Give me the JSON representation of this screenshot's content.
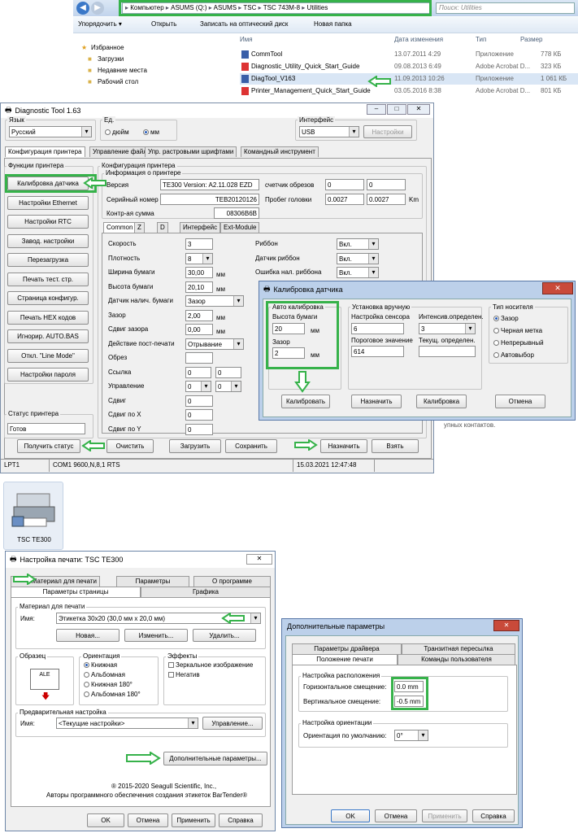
{
  "explorer": {
    "path": [
      "Компьютер",
      "ASUMS (Q:)",
      "ASUMS",
      "TSC",
      "TSC 743M-8",
      "Utilities"
    ],
    "search": "Поиск: Utilities",
    "toolbar": [
      "Упорядочить ▾",
      "Открыть",
      "Записать на оптический диск",
      "Новая папка"
    ],
    "cols": [
      "Имя",
      "Дата изменения",
      "Тип",
      "Размер"
    ],
    "nav": [
      "Избранное",
      "Загрузки",
      "Недавние места",
      "Рабочий стол"
    ],
    "files": [
      {
        "name": "CommTool",
        "date": "13.07.2011 4:29",
        "type": "Приложение",
        "size": "778 КБ"
      },
      {
        "name": "Diagnostic_Utility_Quick_Start_Guide",
        "date": "09.08.2013 6:49",
        "type": "Adobe Acrobat D...",
        "size": "323 КБ"
      },
      {
        "name": "DiagTool_V163",
        "date": "11.09.2013 10:26",
        "type": "Приложение",
        "size": "1 061 КБ"
      },
      {
        "name": "Printer_Management_Quick_Start_Guide",
        "date": "03.05.2016 8:38",
        "type": "Adobe Acrobat D...",
        "size": "801 КБ"
      }
    ]
  },
  "diag": {
    "title": "Diagnostic Tool 1.63",
    "lang_label": "Язык",
    "lang": "Русский",
    "unit_label": "Ед.",
    "units": [
      "дюйм",
      "мм"
    ],
    "iface_label": "Интерфейс",
    "iface": "USB",
    "settings_btn": "Настройки",
    "tabs": [
      "Конфигурация принтера",
      "Управление файлом",
      "Упр. растровыми шрифтами",
      "Командный инструмент"
    ],
    "func_title": "Функции принтера",
    "funcs": [
      "Калибровка датчика",
      "Настройки Ethernet",
      "Настройки RTC",
      "Завод. настройки",
      "Перезагрузка",
      "Печать тест. стр.",
      "Страница конфигур.",
      "Печать HEX кодов",
      "Игнорир. AUTO.BAS",
      "Откл. \"Line Mode\"",
      "Настройки пароля"
    ],
    "status_title": "Статус принтера",
    "status": "Готов",
    "get_status": "Получить статус",
    "cfg_title": "Конфигурация принтера",
    "info_title": "Информация о принтере",
    "version_l": "Версия",
    "version": "TE300 Version: A2.11.028 EZD",
    "cut_l": "счетчик обрезов",
    "cut1": "0",
    "cut2": "0",
    "serial_l": "Серийный номер",
    "serial": "TEB20120126",
    "run_l": "Пробег головки",
    "run1": "0.0027",
    "run2": "0.0027",
    "km": "Km",
    "chk_l": "Контр-ая сумма",
    "chk": "08306B6B",
    "subtabs": [
      "Common",
      "Z",
      "D",
      "Интерфейс",
      "Ext-Module"
    ],
    "left": [
      {
        "l": "Скорость",
        "v": "3",
        "t": "inp"
      },
      {
        "l": "Плотность",
        "v": "8",
        "t": "sel"
      },
      {
        "l": "Ширина бумаги",
        "v": "30,00",
        "u": "мм",
        "t": "inp"
      },
      {
        "l": "Высота бумаги",
        "v": "20,10",
        "u": "мм",
        "t": "inp"
      },
      {
        "l": "Датчик налич. бумаги",
        "v": "Зазор",
        "t": "sel"
      },
      {
        "l": "Зазор",
        "v": "2,00",
        "u": "мм",
        "t": "inp"
      },
      {
        "l": "Сдвиг зазора",
        "v": "0,00",
        "u": "мм",
        "t": "inp"
      },
      {
        "l": "Действие пост-печати",
        "v": "Отрывание",
        "t": "sel"
      },
      {
        "l": "Обрез",
        "v": "",
        "t": "inp"
      },
      {
        "l": "Ссылка",
        "v": "0",
        "v2": "0",
        "t": "inp2"
      },
      {
        "l": "Управление",
        "v": "0",
        "v2": "0",
        "t": "sel2"
      },
      {
        "l": "Сдвиг",
        "v": "0",
        "t": "inp"
      },
      {
        "l": "Сдвиг по X",
        "v": "0",
        "t": "inp"
      },
      {
        "l": "Сдвиг по Y",
        "v": "0",
        "t": "inp"
      }
    ],
    "right": [
      {
        "l": "Риббон",
        "v": "Вкл."
      },
      {
        "l": "Датчик риббон",
        "v": "Вкл."
      },
      {
        "l": "Ошибка нал. риббона",
        "v": "Вкл."
      }
    ],
    "bottom": [
      "Очистить",
      "Загрузить",
      "Сохранить",
      "Назначить",
      "Взять"
    ],
    "sb": [
      "LPT1",
      "COM1 9600,N,8,1 RTS",
      "15.03.2021 12:47:48"
    ]
  },
  "calib": {
    "title": "Калибровка датчика",
    "auto": "Авто калибровка",
    "h_l": "Высота бумаги",
    "h": "20",
    "gap_l": "Зазор",
    "gap": "2",
    "mm": "мм",
    "cal_btn": "Калибровать",
    "manual": "Установка вручную",
    "sens_l": "Настройка сенсора",
    "sens": "6",
    "int_l": "Интенсив.определен.",
    "int": "3",
    "thr_l": "Пороговое значение",
    "thr": "614",
    "cur_l": "Текущ. определен.",
    "cur": "",
    "assign": "Назначить",
    "calibration": "Калибровка",
    "cancel": "Отмена",
    "media": "Тип носителя",
    "media_opts": [
      "Зазор",
      "Черная метка",
      "Непрерывный",
      "Автовыбор"
    ],
    "hint": "упных контактов."
  },
  "icon": {
    "label": "TSC TE300"
  },
  "print": {
    "title": "Настройка печати: TSC TE300",
    "tabs_top": [
      "Материал для печати",
      "Параметры",
      "О программе"
    ],
    "tabs_bot": [
      "Параметры страницы",
      "Графика"
    ],
    "stock_title": "Материал для печати",
    "name_l": "Имя:",
    "stock": "Этикетка 30x20 (30,0 мм x 20,0 мм)",
    "new": "Новая...",
    "edit": "Изменить...",
    "del": "Удалить...",
    "sample": "Образец",
    "sample_txt": "ALE",
    "orient": "Ориентация",
    "orients": [
      "Книжная",
      "Альбомная",
      "Книжная 180°",
      "Альбомная 180°"
    ],
    "effects": "Эффекты",
    "effs": [
      "Зеркальное изображение",
      "Негатив"
    ],
    "preset_title": "Предварительная настройка",
    "preset": "<Текущие настройки>",
    "manage": "Управление...",
    "adv": "Дополнительные параметры...",
    "copy1": "® 2015-2020 Seagull Scientific, Inc.,",
    "copy2": "Авторы программного обеспечения создания этикеток BarTender®",
    "btns": [
      "OK",
      "Отмена",
      "Применить",
      "Справка"
    ]
  },
  "adv": {
    "title": "Дополнительные параметры",
    "tabs_top": [
      "Параметры драйвера",
      "Транзитная пересылка"
    ],
    "tabs_bot": [
      "Положение печати",
      "Команды пользователя"
    ],
    "pos_title": "Настройка расположения",
    "h_l": "Горизонтальное смещение:",
    "h": "0.0 mm",
    "v_l": "Вертикальное смещение:",
    "v": "-0.5 mm",
    "ori_title": "Настройка ориентации",
    "ori_l": "Ориентация по умолчанию:",
    "ori": "0°",
    "btns": [
      "OK",
      "Отмена",
      "Применить",
      "Справка"
    ]
  },
  "colors": {
    "green": "#36b24a",
    "title": "#9db7dc"
  }
}
